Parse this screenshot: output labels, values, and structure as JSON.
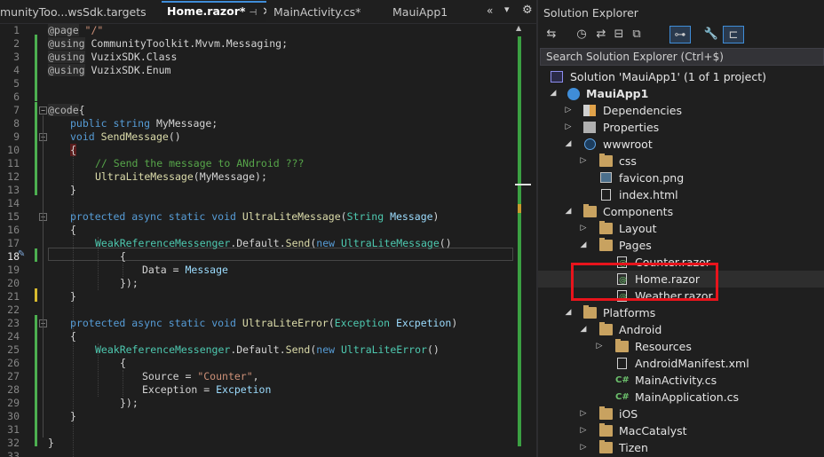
{
  "tabs": [
    {
      "label": "munityToo...wsSdk.targets"
    },
    {
      "label": "Home.razor*",
      "pin": "⊣",
      "close": "✕"
    },
    {
      "label": "MainActivity.cs*"
    },
    {
      "label": "MauiApp1"
    }
  ],
  "tab_controls": {
    "overflow": "«",
    "dropdown": "▾",
    "settings": "⚙"
  },
  "editor": {
    "current_line": 18,
    "line_numbers": [
      "1",
      "2",
      "3",
      "4",
      "5",
      "6",
      "7",
      "8",
      "9",
      "10",
      "11",
      "12",
      "13",
      "14",
      "15",
      "16",
      "17",
      "18",
      "19",
      "20",
      "21",
      "22",
      "23",
      "24",
      "25",
      "26",
      "27",
      "28",
      "29",
      "30",
      "31",
      "32",
      "33"
    ]
  },
  "code": {
    "l1": {
      "a": "@page",
      "b": " \"/\""
    },
    "l2": {
      "a": "@using",
      "b": " CommunityToolkit.Mvvm.Messaging;"
    },
    "l3": {
      "a": "@using",
      "b": " VuzixSDK.Class"
    },
    "l4": {
      "a": "@using",
      "b": " VuzixSDK.Enum"
    },
    "l7": {
      "a": "@code",
      "b": "{"
    },
    "l8": {
      "a": "public",
      "b": " string ",
      "c": "MyMessage;"
    },
    "l9": {
      "a": "void",
      "b": " ",
      "c": "SendMessage",
      "d": "()"
    },
    "l10": {
      "a": "{"
    },
    "l11": {
      "a": "// Send the message to ANdroid ???"
    },
    "l12": {
      "a": "UltraLiteMessage",
      "b": "(MyMessage);"
    },
    "l13": {
      "a": "}"
    },
    "l15": {
      "a": "protected async static void",
      "b": " ",
      "c": "UltraLiteMessage",
      "d": "(",
      "e": "String",
      "f": " ",
      "g": "Message",
      "h": ")"
    },
    "l16": {
      "a": "{"
    },
    "l17": {
      "a": "WeakReferenceMessenger",
      "b": ".Default.",
      "c": "Send",
      "d": "(",
      "e": "new",
      "f": " ",
      "g": "UltraLiteMessage",
      "h": "()"
    },
    "l18": {
      "a": "{"
    },
    "l19": {
      "a": "Data",
      "b": " = ",
      "c": "Message"
    },
    "l20": {
      "a": "});"
    },
    "l21": {
      "a": "}"
    },
    "l23": {
      "a": "protected async static void",
      "b": " ",
      "c": "UltraLiteError",
      "d": "(",
      "e": "Exception",
      "f": " ",
      "g": "Excpetion",
      "h": ")"
    },
    "l24": {
      "a": "{"
    },
    "l25": {
      "a": "WeakReferenceMessenger",
      "b": ".Default.",
      "c": "Send",
      "d": "(",
      "e": "new",
      "f": " ",
      "g": "UltraLiteError",
      "h": "()"
    },
    "l26": {
      "a": "{"
    },
    "l27": {
      "a": "Source",
      "b": " = ",
      "c": "\"Counter\"",
      "d": ","
    },
    "l28": {
      "a": "Exception",
      "b": " = ",
      "c": "Excpetion"
    },
    "l29": {
      "a": "});"
    },
    "l30": {
      "a": "}"
    },
    "l32": {
      "a": "}"
    }
  },
  "solution_explorer": {
    "title": "Solution Explorer",
    "search_placeholder": "Search Solution Explorer (Ctrl+$)",
    "toolbar_icons": [
      "vs-switch-icon",
      "history-icon",
      "sync-icon",
      "collapse-icon",
      "copy-icon",
      "filter-icon",
      "settings-wrench-icon",
      "preview-icon"
    ],
    "tree": [
      {
        "label": "Solution 'MauiApp1' (1 of 1 project)",
        "icon": "solution-icon",
        "arrow": ""
      },
      {
        "label": "MauiApp1",
        "icon": "project-icon",
        "arrow": "◢",
        "bold": true
      },
      {
        "label": "Dependencies",
        "icon": "dependencies-icon",
        "arrow": "▷"
      },
      {
        "label": "Properties",
        "icon": "properties-icon",
        "arrow": "▷"
      },
      {
        "label": "wwwroot",
        "icon": "globe-icon",
        "arrow": "◢"
      },
      {
        "label": "css",
        "icon": "folder-icon",
        "arrow": "▷"
      },
      {
        "label": "favicon.png",
        "icon": "image-icon",
        "arrow": ""
      },
      {
        "label": "index.html",
        "icon": "file-icon",
        "arrow": ""
      },
      {
        "label": "Components",
        "icon": "folder-icon",
        "arrow": "◢"
      },
      {
        "label": "Layout",
        "icon": "folder-icon",
        "arrow": "▷"
      },
      {
        "label": "Pages",
        "icon": "folder-icon",
        "arrow": "◢"
      },
      {
        "label": "Counter.razor",
        "icon": "razor-icon",
        "arrow": ""
      },
      {
        "label": "Home.razor",
        "icon": "razor-icon",
        "arrow": ""
      },
      {
        "label": "Weather.razor",
        "icon": "razor-icon",
        "arrow": ""
      },
      {
        "label": "Platforms",
        "icon": "folder-icon",
        "arrow": "◢"
      },
      {
        "label": "Android",
        "icon": "folder-icon",
        "arrow": "◢"
      },
      {
        "label": "Resources",
        "icon": "folder-icon",
        "arrow": "▷"
      },
      {
        "label": "AndroidManifest.xml",
        "icon": "xml-icon",
        "arrow": ""
      },
      {
        "label": "MainActivity.cs",
        "icon": "csharp-icon",
        "arrow": ""
      },
      {
        "label": "MainApplication.cs",
        "icon": "csharp-icon",
        "arrow": ""
      },
      {
        "label": "iOS",
        "icon": "folder-icon",
        "arrow": "▷"
      },
      {
        "label": "MacCatalyst",
        "icon": "folder-icon",
        "arrow": "▷"
      },
      {
        "label": "Tizen",
        "icon": "folder-icon",
        "arrow": "▷"
      }
    ]
  },
  "colors": {
    "accent": "#3f8dd8",
    "highlight_box": "#e8141c",
    "change_bar": "#4caf50"
  }
}
